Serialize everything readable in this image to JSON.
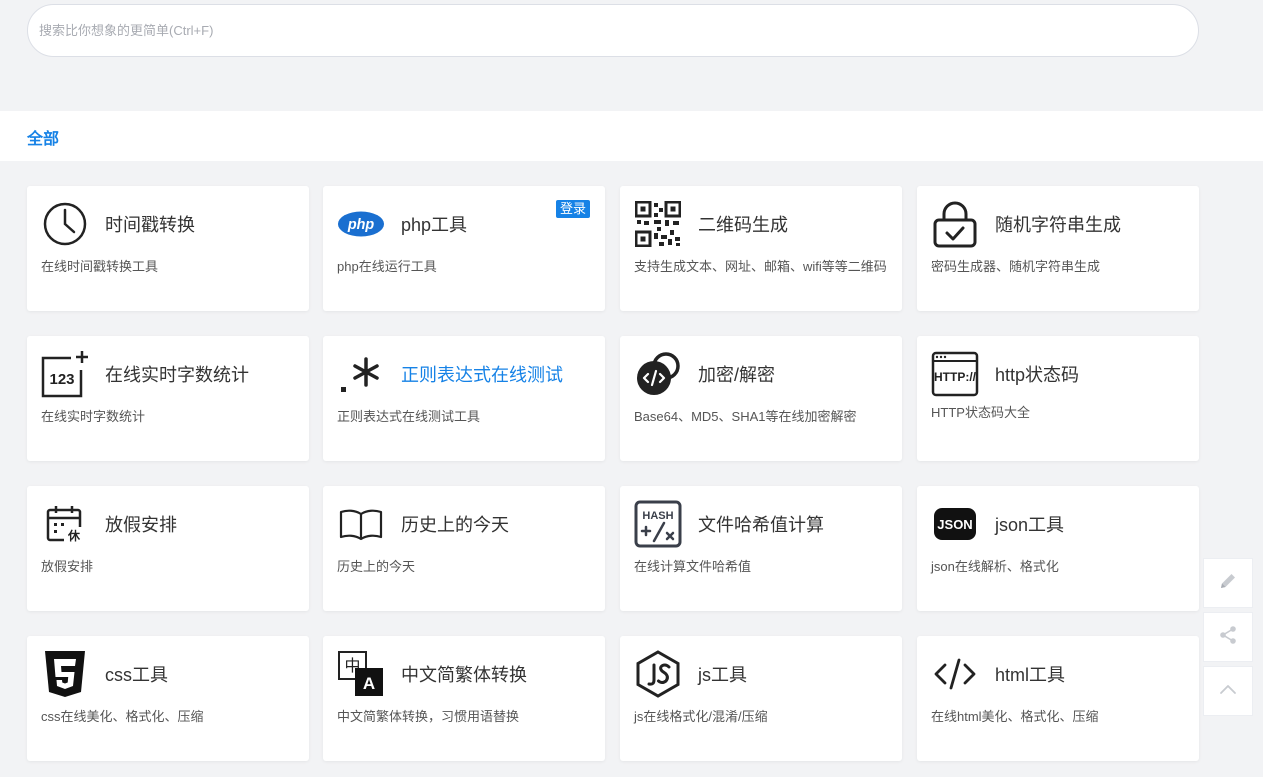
{
  "search": {
    "placeholder": "搜索比你想象的更简单(Ctrl+F)",
    "value": ""
  },
  "category": {
    "all_label": "全部"
  },
  "cards": [
    {
      "title": "时间戳转换",
      "desc": "在线时间戳转换工具",
      "icon": "clock-icon"
    },
    {
      "title": "php工具",
      "desc": "php在线运行工具",
      "icon": "php-logo-icon",
      "badge": "登录"
    },
    {
      "title": "二维码生成",
      "desc": "支持生成文本、网址、邮箱、wifi等等二维码",
      "icon": "qr-code-icon"
    },
    {
      "title": "随机字符串生成",
      "desc": "密码生成器、随机字符串生成",
      "icon": "padlock-icon"
    },
    {
      "title": "在线实时字数统计",
      "desc": "在线实时字数统计",
      "icon": "counter-123-icon"
    },
    {
      "title": "正则表达式在线测试",
      "desc": "正则表达式在线测试工具",
      "icon": "regex-icon",
      "highlight": true
    },
    {
      "title": "加密/解密",
      "desc": "Base64、MD5、SHA1等在线加密解密",
      "icon": "encrypt-icon"
    },
    {
      "title": "http状态码",
      "desc": "HTTP状态码大全",
      "icon": "http-window-icon"
    },
    {
      "title": "放假安排",
      "desc": "放假安排",
      "icon": "holiday-calendar-icon"
    },
    {
      "title": "历史上的今天",
      "desc": "历史上的今天",
      "icon": "open-book-icon"
    },
    {
      "title": "文件哈希值计算",
      "desc": "在线计算文件哈希值",
      "icon": "hash-calculator-icon"
    },
    {
      "title": "json工具",
      "desc": "json在线解析、格式化",
      "icon": "json-icon"
    },
    {
      "title": "css工具",
      "desc": "css在线美化、格式化、压缩",
      "icon": "css3-shield-icon"
    },
    {
      "title": "中文简繁体转换",
      "desc": "中文简繁体转换，习惯用语替换",
      "icon": "chinese-translate-icon"
    },
    {
      "title": "js工具",
      "desc": "js在线格式化/混淆/压缩",
      "icon": "js-hexagon-icon"
    },
    {
      "title": "html工具",
      "desc": "在线html美化、格式化、压缩",
      "icon": "code-brackets-icon"
    }
  ],
  "side_tools": [
    {
      "icon": "pencil-icon"
    },
    {
      "icon": "share-icon"
    },
    {
      "icon": "chevron-up-icon"
    }
  ]
}
